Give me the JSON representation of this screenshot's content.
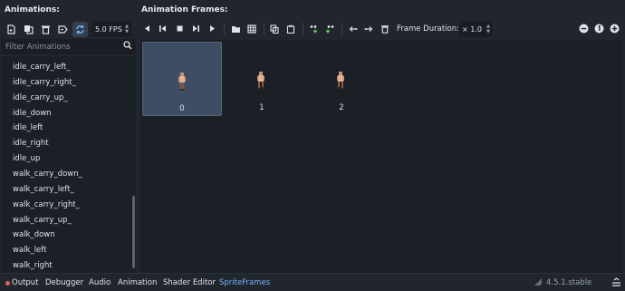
{
  "left_panel": {
    "title": "Animations:",
    "fps": "5.0 FPS",
    "filter_placeholder": "Filter Animations",
    "items": [
      "idle_carry_left_",
      "idle_carry_right_",
      "idle_carry_up_",
      "idle_down",
      "idle_left",
      "idle_right",
      "idle_up",
      "walk_carry_down_",
      "walk_carry_left_",
      "walk_carry_right_",
      "walk_carry_up_",
      "walk_down",
      "walk_left",
      "walk_right"
    ]
  },
  "right_panel": {
    "title": "Animation Frames:",
    "frame_duration_label": "Frame Duration:",
    "frame_duration_value": "× 1.0",
    "frames": [
      "0",
      "1",
      "2"
    ],
    "selected_frame": "0"
  },
  "bottom_bar": {
    "tabs": [
      "Output",
      "Debugger",
      "Audio",
      "Animation",
      "Shader Editor",
      "SpriteFrames"
    ],
    "active_tab": "SpriteFrames",
    "version": "4.5.1.stable"
  },
  "colors": {
    "accent": "#6fb6ff",
    "background": "#21262e",
    "selected_frame": "#3d4d63",
    "error_dot": "#e0625a"
  }
}
